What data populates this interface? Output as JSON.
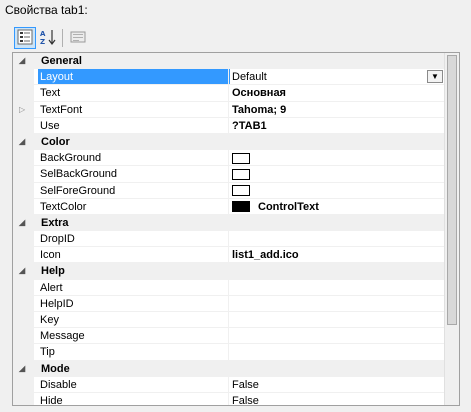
{
  "window": {
    "title": "Свойства tab1:"
  },
  "toolbar": {
    "buttons": [
      {
        "icon": "categorized-icon",
        "active": true
      },
      {
        "icon": "alphabetical-sort-icon",
        "active": false
      },
      {
        "icon": "property-pages-icon",
        "active": false
      }
    ]
  },
  "grid": {
    "selected_property": "Layout",
    "categories": [
      {
        "name": "General",
        "properties": [
          {
            "name": "Layout",
            "value": "Default",
            "dropdown": true
          },
          {
            "name": "Text",
            "value": "Основная",
            "bold": true
          },
          {
            "name": "TextFont",
            "value": "Tahoma; 9",
            "bold": true,
            "expandable": true
          },
          {
            "name": "Use",
            "value": "?TAB1",
            "bold": true
          }
        ]
      },
      {
        "name": "Color",
        "properties": [
          {
            "name": "BackGround",
            "swatch": "#ffffff"
          },
          {
            "name": "SelBackGround",
            "swatch": "#ffffff"
          },
          {
            "name": "SelForeGround",
            "swatch": "#ffffff"
          },
          {
            "name": "TextColor",
            "swatch": "#000000",
            "value": "ControlText",
            "bold": true
          }
        ]
      },
      {
        "name": "Extra",
        "properties": [
          {
            "name": "DropID",
            "value": ""
          },
          {
            "name": "Icon",
            "value": "list1_add.ico",
            "bold": true
          }
        ]
      },
      {
        "name": "Help",
        "properties": [
          {
            "name": "Alert",
            "value": ""
          },
          {
            "name": "HelpID",
            "value": ""
          },
          {
            "name": "Key",
            "value": ""
          },
          {
            "name": "Message",
            "value": ""
          },
          {
            "name": "Tip",
            "value": ""
          }
        ]
      },
      {
        "name": "Mode",
        "properties": [
          {
            "name": "Disable",
            "value": "False"
          },
          {
            "name": "Hide",
            "value": "False"
          }
        ]
      }
    ]
  }
}
